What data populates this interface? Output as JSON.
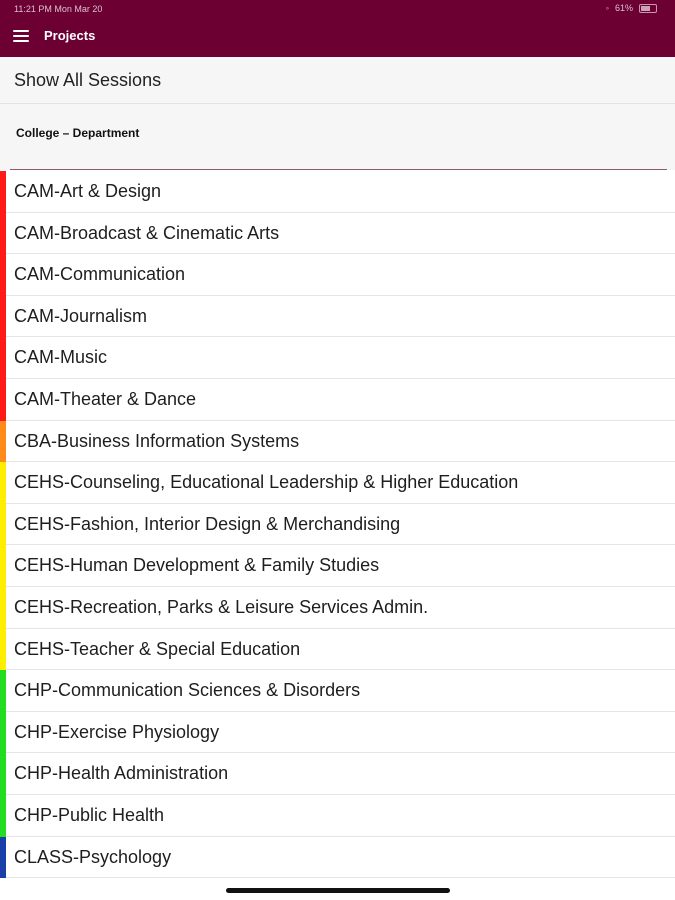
{
  "status_bar": {
    "time_date": "11:21 PM  Mon Mar 20",
    "battery": "61%"
  },
  "header": {
    "title": "Projects",
    "menu_icon": "hamburger-menu-icon",
    "background": "#6c0033"
  },
  "show_all": {
    "label": "Show All Sessions"
  },
  "section": {
    "label": "College – Department"
  },
  "departments": [
    {
      "label": "CAM-Art & Design",
      "color": "#ff1a1a"
    },
    {
      "label": "CAM-Broadcast & Cinematic Arts",
      "color": "#ff1a1a"
    },
    {
      "label": "CAM-Communication",
      "color": "#ff1a1a"
    },
    {
      "label": "CAM-Journalism",
      "color": "#ff1a1a"
    },
    {
      "label": "CAM-Music",
      "color": "#ff1a1a"
    },
    {
      "label": "CAM-Theater & Dance",
      "color": "#ff1a1a"
    },
    {
      "label": "CBA-Business Information Systems",
      "color": "#ff8c1a"
    },
    {
      "label": "CEHS-Counseling, Educational Leadership & Higher Education",
      "color": "#ffee00"
    },
    {
      "label": "CEHS-Fashion, Interior Design & Merchandising",
      "color": "#ffee00"
    },
    {
      "label": "CEHS-Human Development & Family Studies",
      "color": "#ffee00"
    },
    {
      "label": "CEHS-Recreation, Parks & Leisure Services Admin.",
      "color": "#ffee00"
    },
    {
      "label": "CEHS-Teacher & Special Education",
      "color": "#ffee00"
    },
    {
      "label": "CHP-Communication Sciences & Disorders",
      "color": "#22dd22"
    },
    {
      "label": "CHP-Exercise Physiology",
      "color": "#22dd22"
    },
    {
      "label": "CHP-Health Administration",
      "color": "#22dd22"
    },
    {
      "label": "CHP-Public Health",
      "color": "#22dd22"
    },
    {
      "label": "CLASS-Psychology",
      "color": "#1a3fa8"
    }
  ]
}
